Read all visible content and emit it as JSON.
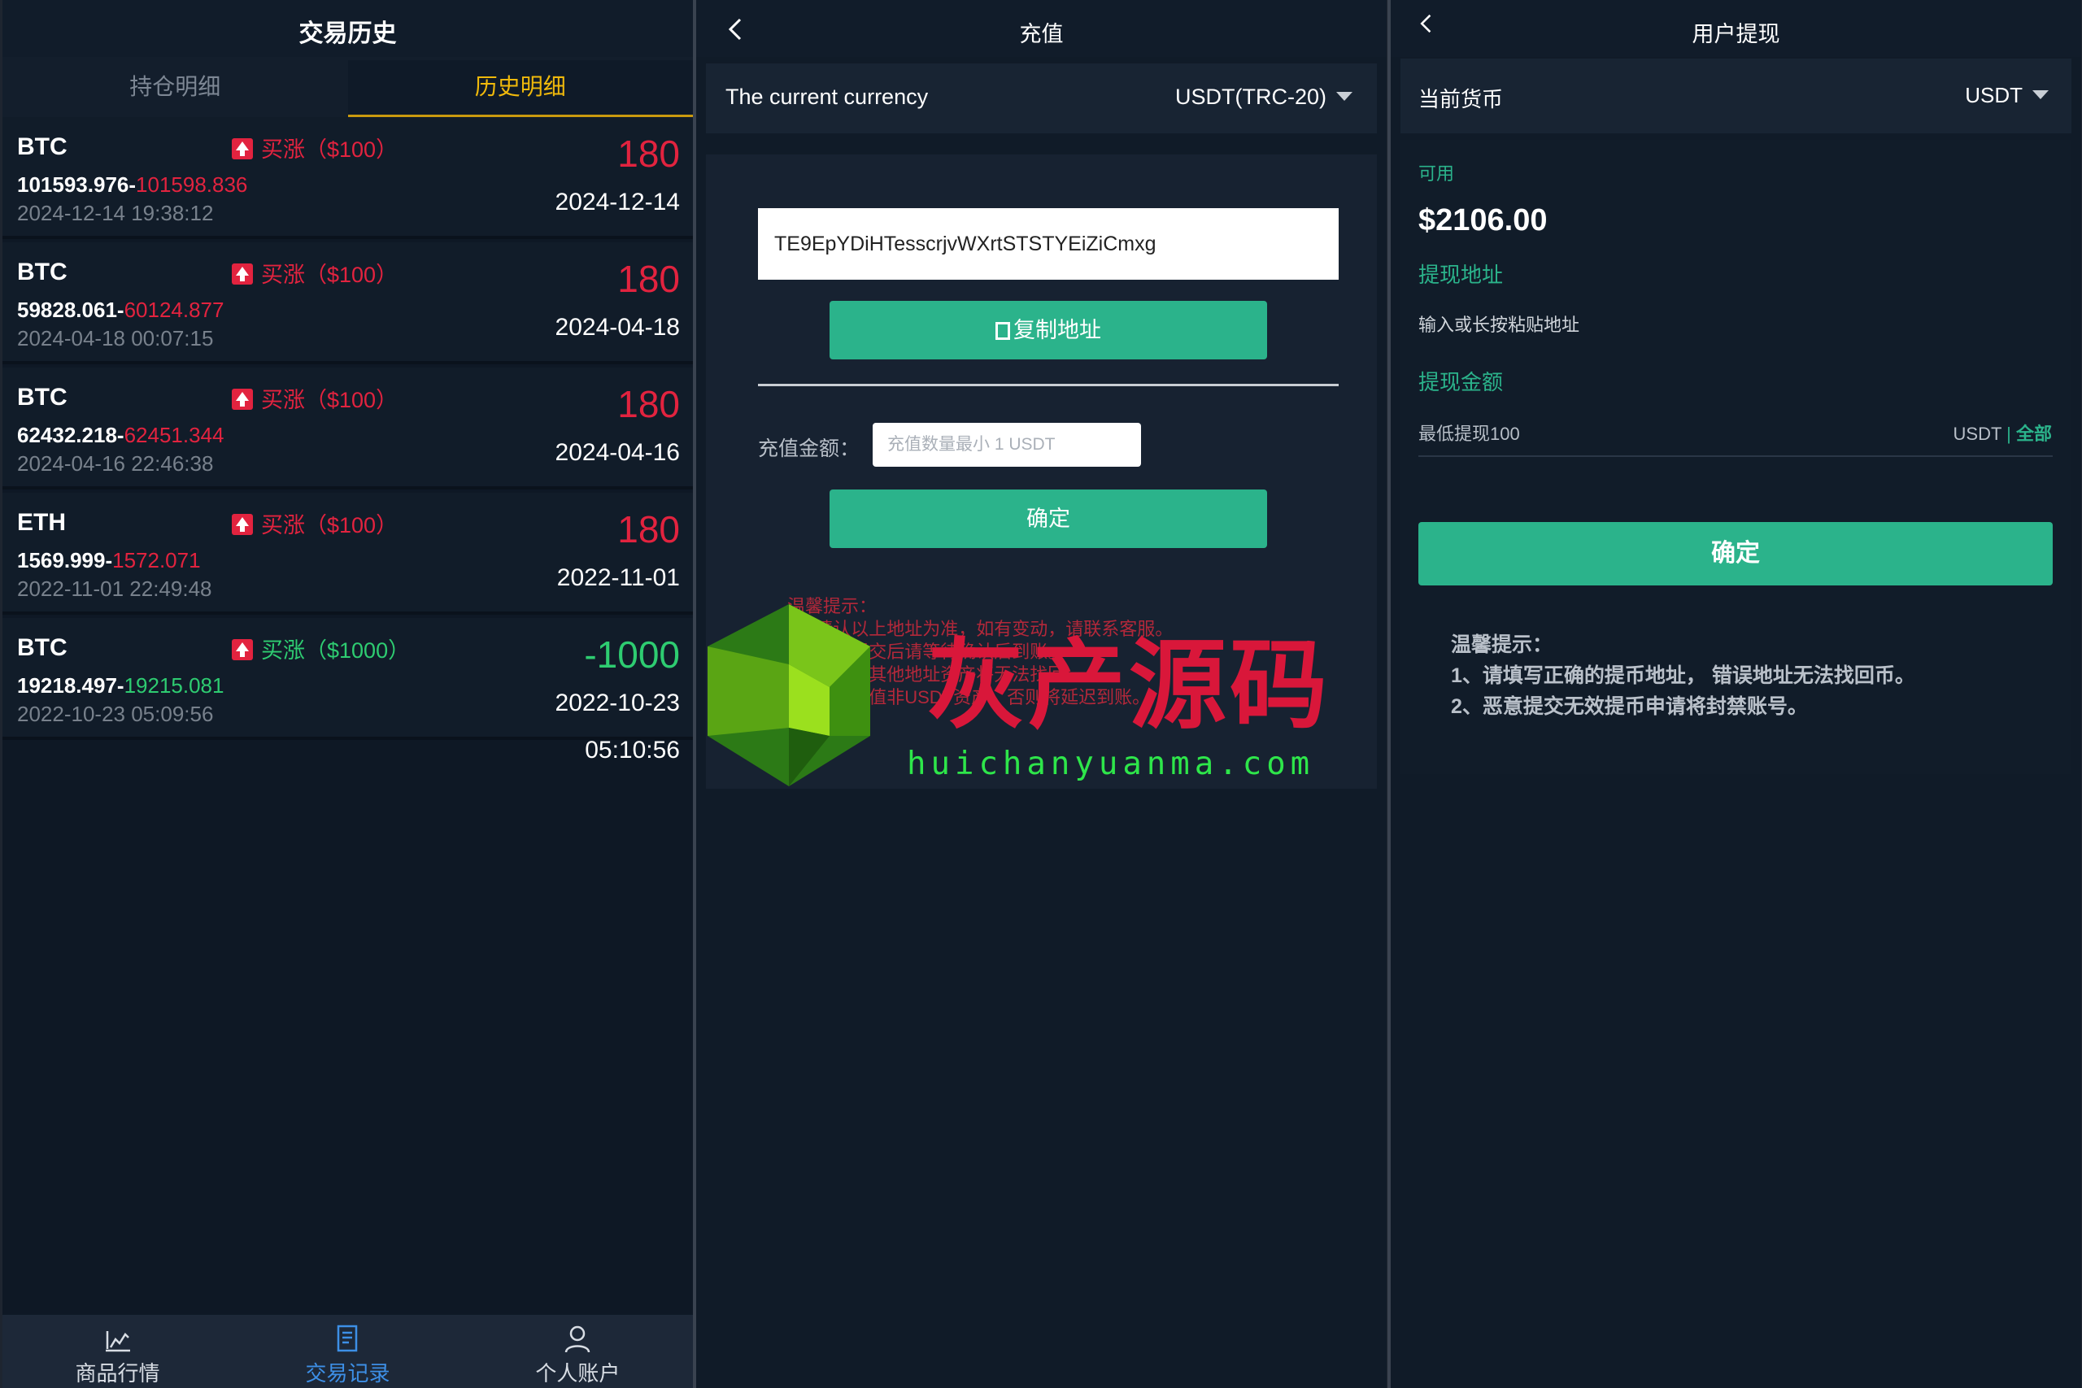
{
  "history_screen": {
    "title": "交易历史",
    "tabs": [
      "持仓明细",
      "历史明细"
    ],
    "trades": [
      {
        "symbol": "BTC",
        "direction": "买涨",
        "amount": "（$100）",
        "profit": "180",
        "open_price": "101593.976-",
        "close_price": "101598.836",
        "time": "2024-12-14 19:38:12",
        "date": "2024-12-14",
        "extra": "",
        "profit_color": "red",
        "close_color": "red",
        "direction_color": "red"
      },
      {
        "symbol": "BTC",
        "direction": "买涨",
        "amount": "（$100）",
        "profit": "180",
        "open_price": "59828.061-",
        "close_price": "60124.877",
        "time": "2024-04-18 00:07:15",
        "date": "2024-04-18",
        "extra": "",
        "profit_color": "red",
        "close_color": "red",
        "direction_color": "red"
      },
      {
        "symbol": "BTC",
        "direction": "买涨",
        "amount": "（$100）",
        "profit": "180",
        "open_price": "62432.218-",
        "close_price": "62451.344",
        "time": "2024-04-16 22:46:38",
        "date": "2024-04-16",
        "extra": "",
        "profit_color": "red",
        "close_color": "red",
        "direction_color": "red"
      },
      {
        "symbol": "ETH",
        "direction": "买涨",
        "amount": "（$100）",
        "profit": "180",
        "open_price": "1569.999-",
        "close_price": "1572.071",
        "time": "2022-11-01 22:49:48",
        "date": "2022-11-01",
        "extra": "",
        "profit_color": "red",
        "close_color": "red",
        "direction_color": "red"
      },
      {
        "symbol": "BTC",
        "direction": "买涨",
        "amount": "（$1000）",
        "profit": "-1000",
        "open_price": "19218.497-",
        "close_price": "19215.081",
        "time": "2022-10-23 05:09:56",
        "date": "2022-10-23",
        "extra": "05:10:56",
        "profit_color": "green",
        "close_color": "green",
        "direction_color": "green"
      }
    ],
    "nav": [
      {
        "label": "商品行情",
        "icon": "chart-icon"
      },
      {
        "label": "交易记录",
        "icon": "records-icon"
      },
      {
        "label": "个人账户",
        "icon": "user-icon"
      }
    ]
  },
  "deposit_screen": {
    "title": "充值",
    "currency_label": "The current currency",
    "currency_value": "USDT(TRC-20)",
    "address": "TE9EpYDiHTesscrjvWXrtSTSTYEiZiCmxg",
    "copy_button": "复制地址",
    "amount_label": "充值金额：",
    "amount_placeholder": "充值数量最小 1 USDT",
    "confirm_button": "确定",
    "tips": [
      "温馨提示：",
      "1、请认以上地址为准，如有变动，请联系客服。",
      "2、充币提交后请等待确认后到账。",
      "3、充值至其他地址资产将无法找回。",
      "4、请勿充值非USDT资产，否则将延迟到账。"
    ]
  },
  "withdraw_screen": {
    "title": "用户提现",
    "currency_label": "当前货币",
    "currency_value": "USDT",
    "available_label": "可用",
    "balance": "$2106.00",
    "address_label": "提现地址",
    "address_placeholder": "输入或长按粘贴地址",
    "amount_label": "提现金额",
    "min_withdraw": "最低提现100",
    "unit": "USDT",
    "separator": "|",
    "all_label": "全部",
    "confirm_button": "确定",
    "tips": [
      "温馨提示：",
      "1、请填写正确的提币地址， 错误地址无法找回币。",
      "2、恶意提交无效提币申请将封禁账号。"
    ]
  },
  "watermark": {
    "title": "灰产源码",
    "url": "huichanyuanma.com"
  },
  "colors": {
    "accent_green": "#2bb38b",
    "loss_red": "#e2233f",
    "gain_green": "#2ecc71",
    "tab_gold": "#f0b90b",
    "nav_blue": "#3d8fe6"
  }
}
